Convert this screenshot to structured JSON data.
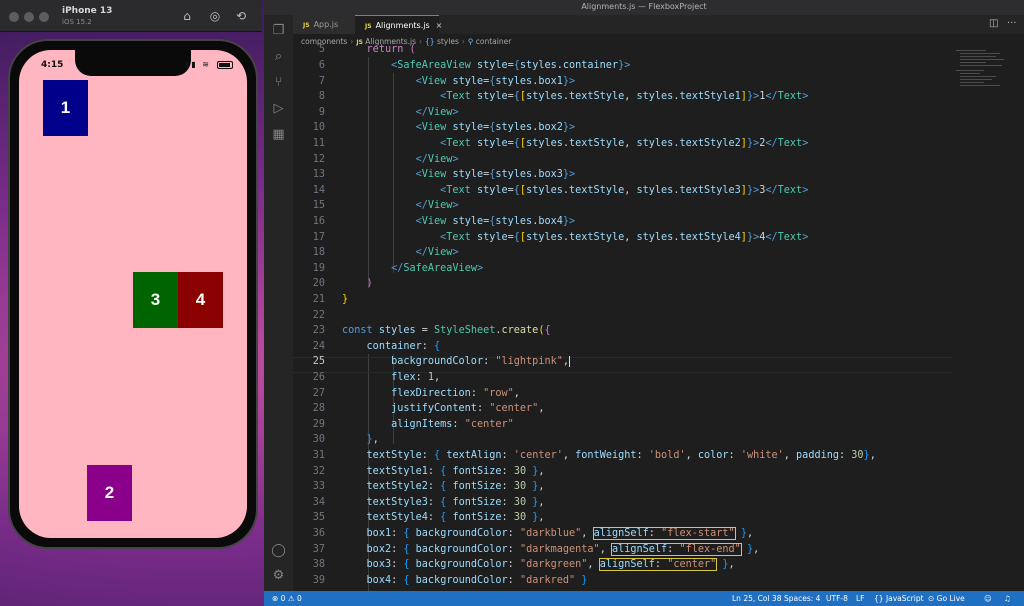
{
  "simulator": {
    "title": "iPhone 13",
    "subtitle": "iOS 15.2",
    "toolbar_icons": [
      "home-icon",
      "screenshot-icon",
      "rotate-icon"
    ],
    "status_time": "4:15",
    "background_color": "#ffb6c1",
    "boxes": [
      {
        "label": "1",
        "color": "#00008b"
      },
      {
        "label": "2",
        "color": "#8b008b"
      },
      {
        "label": "3",
        "color": "#006400"
      },
      {
        "label": "4",
        "color": "#8b0000"
      }
    ]
  },
  "vscode": {
    "window_title": "Alignments.js — FlexboxProject",
    "tabs": [
      {
        "label": "App.js",
        "badge": "JS"
      },
      {
        "label": "Alignments.js",
        "badge": "JS",
        "active": true
      }
    ],
    "breadcrumbs": {
      "folder": "components",
      "file": "Alignments.js",
      "symbol1": "styles",
      "symbol2": "container",
      "badge": "JS"
    },
    "status": {
      "errors": "0",
      "warnings": "0",
      "position": "Ln 25, Col 38",
      "spaces": "Spaces: 4",
      "encoding": "UTF-8",
      "eol": "LF",
      "language": "JavaScript",
      "golive": "Go Live"
    }
  }
}
